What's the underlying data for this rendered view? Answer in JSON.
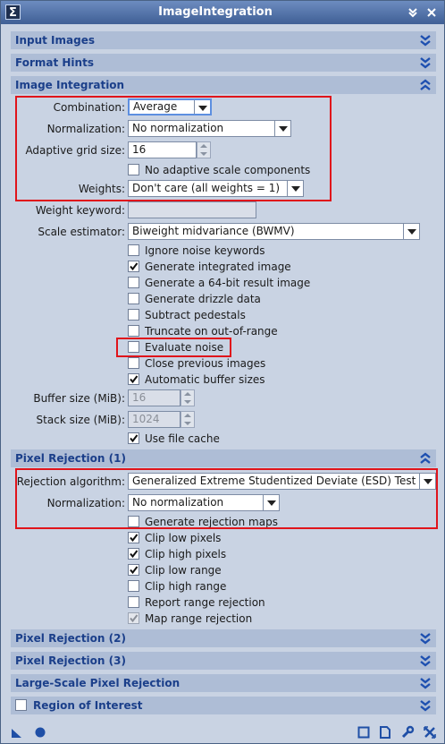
{
  "window": {
    "title": "ImageIntegration",
    "sigma": "Σ"
  },
  "sections": {
    "input_images": "Input Images",
    "format_hints": "Format Hints",
    "image_integration": "Image Integration",
    "pixel_rejection_1": "Pixel Rejection (1)",
    "pixel_rejection_2": "Pixel Rejection (2)",
    "pixel_rejection_3": "Pixel Rejection (3)",
    "large_scale": "Large-Scale Pixel Rejection",
    "roi": "Region of Interest"
  },
  "integration": {
    "combination_label": "Combination:",
    "combination_value": "Average",
    "normalization_label": "Normalization:",
    "normalization_value": "No normalization",
    "adaptive_grid_label": "Adaptive grid size:",
    "adaptive_grid_value": "16",
    "no_adaptive_scale": "No adaptive scale components",
    "weights_label": "Weights:",
    "weights_value": "Don't care (all weights = 1)",
    "weight_keyword_label": "Weight keyword:",
    "weight_keyword_value": "",
    "scale_estimator_label": "Scale estimator:",
    "scale_estimator_value": "Biweight midvariance (BWMV)",
    "checkboxes": [
      {
        "label": "Ignore noise keywords",
        "checked": false
      },
      {
        "label": "Generate integrated image",
        "checked": true
      },
      {
        "label": "Generate a 64-bit result image",
        "checked": false
      },
      {
        "label": "Generate drizzle data",
        "checked": false
      },
      {
        "label": "Subtract pedestals",
        "checked": false
      },
      {
        "label": "Truncate on out-of-range",
        "checked": false
      },
      {
        "label": "Evaluate noise",
        "checked": false
      },
      {
        "label": "Close previous images",
        "checked": false
      },
      {
        "label": "Automatic buffer sizes",
        "checked": true
      }
    ],
    "buffer_size_label": "Buffer size (MiB):",
    "buffer_size_value": "16",
    "stack_size_label": "Stack size (MiB):",
    "stack_size_value": "1024",
    "use_file_cache": "Use file cache"
  },
  "rejection": {
    "algorithm_label": "Rejection algorithm:",
    "algorithm_value": "Generalized Extreme Studentized Deviate (ESD) Test",
    "normalization_label": "Normalization:",
    "normalization_value": "No normalization",
    "checkboxes": [
      {
        "label": "Generate rejection maps",
        "checked": false
      },
      {
        "label": "Clip low pixels",
        "checked": true
      },
      {
        "label": "Clip high pixels",
        "checked": true
      },
      {
        "label": "Clip low range",
        "checked": true
      },
      {
        "label": "Clip high range",
        "checked": false
      },
      {
        "label": "Report range rejection",
        "checked": false
      },
      {
        "label": "Map range rejection",
        "checked": true,
        "disabled": true
      }
    ]
  },
  "colors": {
    "title_bar": "#4f6fa8",
    "section_text": "#1b3f8a",
    "highlight": "#e0141b",
    "panel": "#c9d3e3"
  },
  "icons": [
    "new-instance-icon",
    "apply-global-icon",
    "new-window-icon",
    "document-icon",
    "wrench-icon",
    "reset-icon"
  ]
}
